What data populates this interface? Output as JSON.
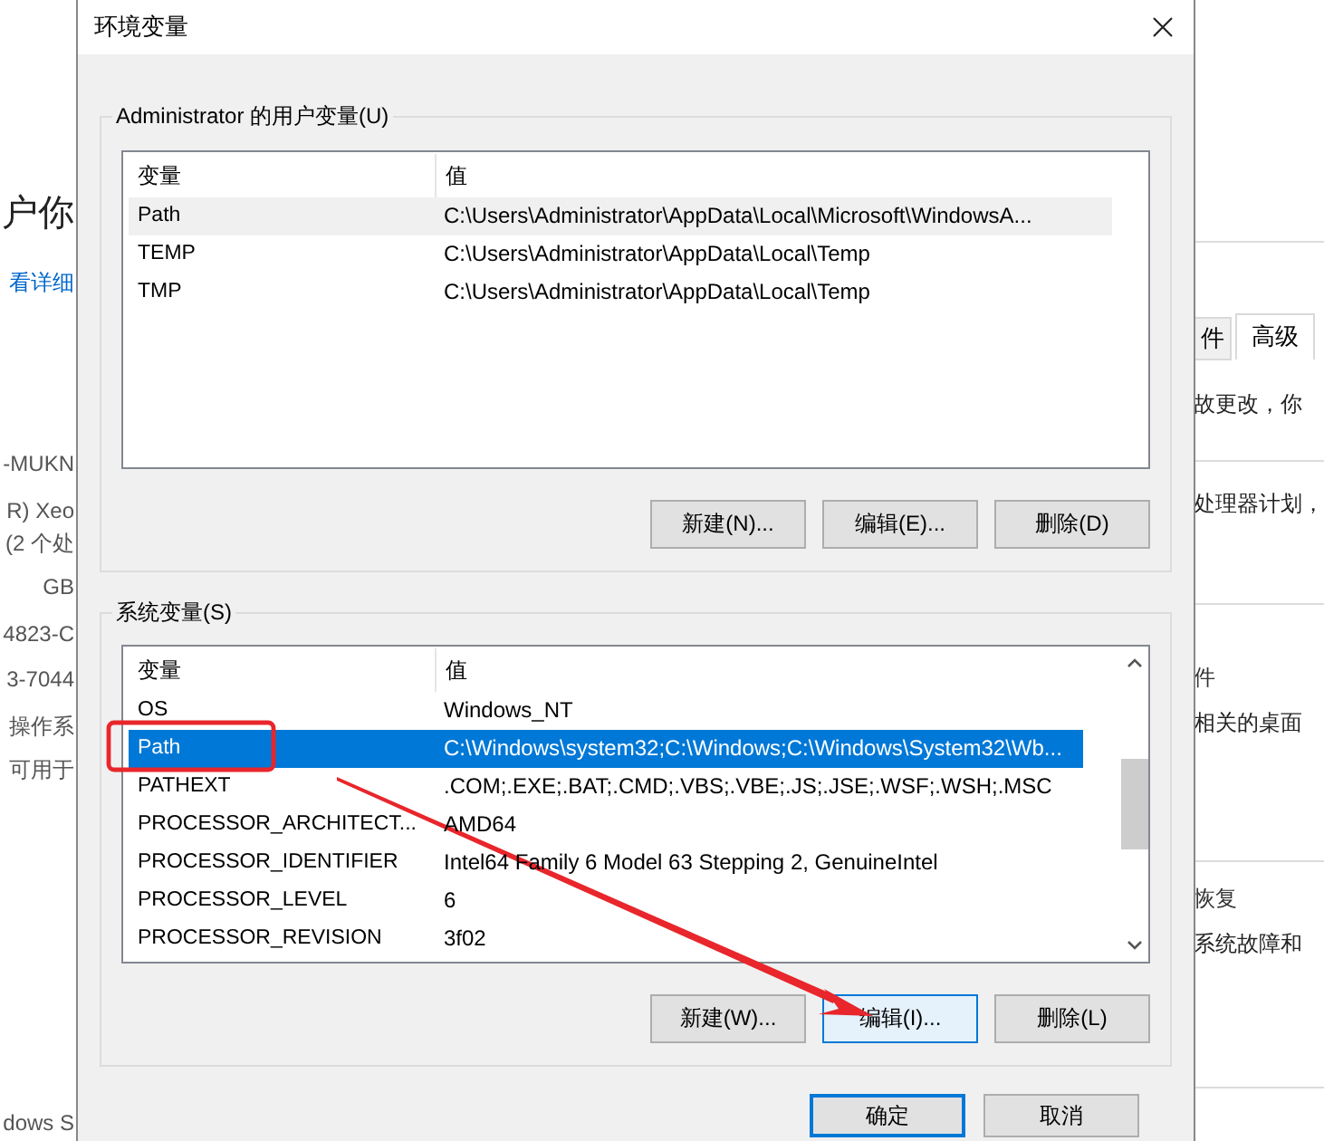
{
  "background_window": {
    "left_texts": [
      {
        "text": "户你",
        "kind": "heading"
      },
      {
        "text": "看详细",
        "kind": "link"
      },
      {
        "text": "-MUKN",
        "kind": "plain"
      },
      {
        "text": "R) Xeo",
        "kind": "plain"
      },
      {
        "text": "(2 个处",
        "kind": "plain"
      },
      {
        "text": "GB",
        "kind": "plain"
      },
      {
        "text": "4823-C",
        "kind": "plain"
      },
      {
        "text": "3-7044",
        "kind": "plain"
      },
      {
        "text": "操作系",
        "kind": "plain"
      },
      {
        "text": "可用于",
        "kind": "plain"
      },
      {
        "text": "dows S",
        "kind": "plain"
      }
    ],
    "tabs": [
      {
        "label": "件",
        "selected": false
      },
      {
        "label": "高级",
        "selected": true
      }
    ],
    "right_texts": [
      {
        "text": "故更改，你",
        "kind": "plain"
      },
      {
        "text": "处理器计划，",
        "kind": "plain"
      },
      {
        "text": "件",
        "kind": "section"
      },
      {
        "text": "相关的桌面",
        "kind": "plain"
      },
      {
        "text": "恢复",
        "kind": "section"
      },
      {
        "text": "系统故障和",
        "kind": "plain"
      }
    ]
  },
  "dialog": {
    "title": "环境变量",
    "user_vars": {
      "legend": "Administrator 的用户变量(U)",
      "focused": false,
      "columns": [
        "变量",
        "值"
      ],
      "rows": [
        {
          "name": "Path",
          "value": "C:\\Users\\Administrator\\AppData\\Local\\Microsoft\\WindowsA...",
          "selected": true
        },
        {
          "name": "TEMP",
          "value": "C:\\Users\\Administrator\\AppData\\Local\\Temp",
          "selected": false
        },
        {
          "name": "TMP",
          "value": "C:\\Users\\Administrator\\AppData\\Local\\Temp",
          "selected": false
        }
      ],
      "buttons": [
        {
          "label": "新建(N)...",
          "focused": false
        },
        {
          "label": "编辑(E)...",
          "focused": false
        },
        {
          "label": "删除(D)",
          "focused": false
        }
      ]
    },
    "system_vars": {
      "legend": "系统变量(S)",
      "focused": true,
      "columns": [
        "变量",
        "值"
      ],
      "rows": [
        {
          "name": "OS",
          "value": "Windows_NT",
          "selected": false
        },
        {
          "name": "Path",
          "value": "C:\\Windows\\system32;C:\\Windows;C:\\Windows\\System32\\Wb...",
          "selected": true
        },
        {
          "name": "PATHEXT",
          "value": ".COM;.EXE;.BAT;.CMD;.VBS;.VBE;.JS;.JSE;.WSF;.WSH;.MSC",
          "selected": false
        },
        {
          "name": "PROCESSOR_ARCHITECT...",
          "value": "AMD64",
          "selected": false
        },
        {
          "name": "PROCESSOR_IDENTIFIER",
          "value": "Intel64 Family 6 Model 63 Stepping 2, GenuineIntel",
          "selected": false
        },
        {
          "name": "PROCESSOR_LEVEL",
          "value": "6",
          "selected": false
        },
        {
          "name": "PROCESSOR_REVISION",
          "value": "3f02",
          "selected": false
        }
      ],
      "buttons": [
        {
          "label": "新建(W)...",
          "focused": false
        },
        {
          "label": "编辑(I)...",
          "focused": true
        },
        {
          "label": "删除(L)",
          "focused": false
        }
      ]
    },
    "footer_buttons": [
      {
        "label": "确定",
        "default": true
      },
      {
        "label": "取消",
        "default": false
      }
    ]
  }
}
